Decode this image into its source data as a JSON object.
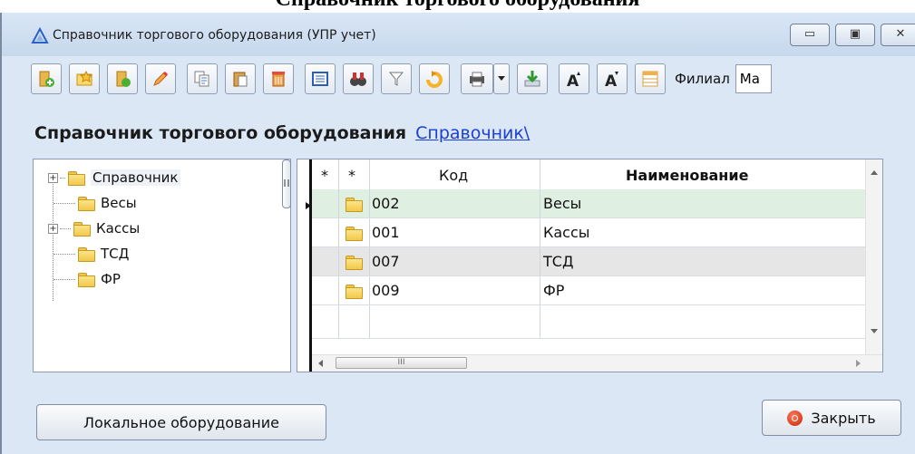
{
  "clipped_heading": "Справочник торгового оборудования",
  "window": {
    "title": "Справочник торгового оборудования (УПР учет)",
    "buttons": {
      "minimize": "▭",
      "maximize": "▣",
      "close": "✕"
    }
  },
  "toolbar": {
    "filial_label": "Филиал",
    "filial_value": "Ма"
  },
  "header": {
    "title": "Справочник торгового оборудования",
    "breadcrumb_link": "Справочник\\"
  },
  "tree": {
    "root": "Справочник",
    "items": [
      "Весы",
      "Кассы",
      "ТСД",
      "ФР"
    ]
  },
  "grid": {
    "columns": [
      "*",
      "*",
      "Код",
      "Наименование"
    ],
    "rows": [
      {
        "code": "002",
        "name": "Весы"
      },
      {
        "code": "001",
        "name": "Кассы"
      },
      {
        "code": "007",
        "name": "ТСД"
      },
      {
        "code": "009",
        "name": "ФР"
      }
    ],
    "scroll_thumb": "III"
  },
  "buttons": {
    "local_equipment": "Локальное оборудование",
    "close": "Закрыть"
  },
  "colors": {
    "selected_row": "#dff0e2",
    "alt_row": "#e6e6e6",
    "link": "#1a3fd6"
  }
}
